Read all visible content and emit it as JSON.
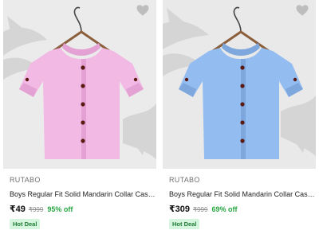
{
  "products": [
    {
      "brand": "RUTABO",
      "title": "Boys Regular Fit Solid Mandarin Collar Casual...",
      "price": "₹49",
      "mrp": "₹999",
      "discount": "95% off",
      "badge": "Hot Deal",
      "shirt_color": "#f2b9e4",
      "shirt_shadow": "#e3a2d3",
      "image_bg": "#ebebeb"
    },
    {
      "brand": "RUTABO",
      "title": "Boys Regular Fit Solid Mandarin Collar Casual...",
      "price": "₹309",
      "mrp": "₹999",
      "discount": "69% off",
      "badge": "Hot Deal",
      "shirt_color": "#93bdf0",
      "shirt_shadow": "#7ea8dd",
      "image_bg": "#e9e9e9"
    }
  ],
  "colors": {
    "discount": "#26a541",
    "badge_bg": "#d6f5df",
    "badge_text": "#1e7b34",
    "button": "#5a1a12"
  },
  "icons": {
    "wishlist": "heart-icon"
  }
}
